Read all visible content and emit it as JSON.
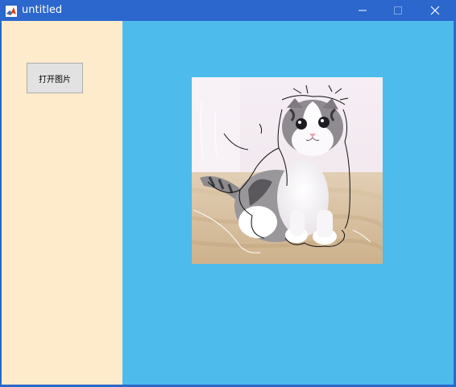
{
  "window": {
    "title": "untitled",
    "app_icon": "matlab-icon",
    "controls": {
      "minimize_icon": "minimize-icon",
      "maximize_icon": "maximize-icon",
      "close_icon": "close-icon"
    }
  },
  "left_panel": {
    "background": "#fdebcc",
    "open_button_label": "打开图片"
  },
  "right_panel": {
    "background": "#4dbbec",
    "image": {
      "subject": "cat-photo-with-edge-lines"
    }
  },
  "colors": {
    "titlebar": "#2b67cc",
    "left_panel": "#fdebcc",
    "right_panel": "#4dbbec"
  }
}
